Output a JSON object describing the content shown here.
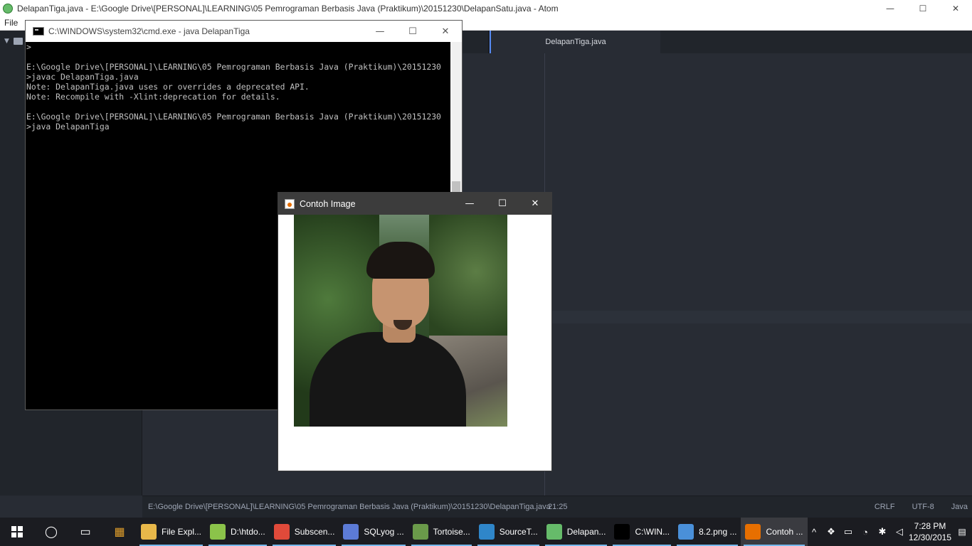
{
  "atom": {
    "title": "DelapanTiga.java - E:\\Google Drive\\[PERSONAL]\\LEARNING\\05 Pemrograman Berbasis Java (Praktikum)\\20151230\\DelapanSatu.java - Atom",
    "menu_file": "File",
    "tab_active": "DelapanTiga.java",
    "status_path": "E:\\Google Drive\\[PERSONAL]\\LEARNING\\05 Pemrograman Berbasis Java (Praktikum)\\20151230\\DelapanTiga.java",
    "status_position": "21:25",
    "status_line_ending": "CRLF",
    "status_encoding": "UTF-8",
    "status_grammar": "Java"
  },
  "cmd": {
    "title": "C:\\WINDOWS\\system32\\cmd.exe - java  DelapanTiga",
    "lines": [
      ">",
      "",
      "E:\\Google Drive\\[PERSONAL]\\LEARNING\\05 Pemrograman Berbasis Java (Praktikum)\\20151230",
      ">javac DelapanTiga.java",
      "Note: DelapanTiga.java uses or overrides a deprecated API.",
      "Note: Recompile with -Xlint:deprecation for details.",
      "",
      "E:\\Google Drive\\[PERSONAL]\\LEARNING\\05 Pemrograman Berbasis Java (Praktikum)\\20151230",
      ">java DelapanTiga"
    ]
  },
  "java_window": {
    "title": "Contoh Image"
  },
  "window_controls": {
    "minimize": "—",
    "maximize": "☐",
    "close": "✕"
  },
  "taskbar": {
    "apps": [
      {
        "label": "File Expl...",
        "icon": "file-explorer-icon",
        "color": "#e8b84a"
      },
      {
        "label": "D:\\htdo...",
        "icon": "notepad-plus-icon",
        "color": "#8bc34a"
      },
      {
        "label": "Subscen...",
        "icon": "chrome-icon",
        "color": "#e04a3a"
      },
      {
        "label": "SQLyog ...",
        "icon": "sqlyog-icon",
        "color": "#5c7bd6"
      },
      {
        "label": "Tortoise...",
        "icon": "tortoise-icon",
        "color": "#6a9a4a"
      },
      {
        "label": "SourceT...",
        "icon": "sourcetree-icon",
        "color": "#2f86c9"
      },
      {
        "label": "Delapan...",
        "icon": "atom-icon",
        "color": "#66bb6a"
      },
      {
        "label": "C:\\WIN...",
        "icon": "cmd-icon",
        "color": "#000000"
      },
      {
        "label": "8.2.png ...",
        "icon": "paint-icon",
        "color": "#4a90d9"
      },
      {
        "label": "Contoh ...",
        "icon": "java-icon",
        "color": "#e76f00"
      }
    ],
    "clock_time": "7:28 PM",
    "clock_date": "12/30/2015"
  }
}
